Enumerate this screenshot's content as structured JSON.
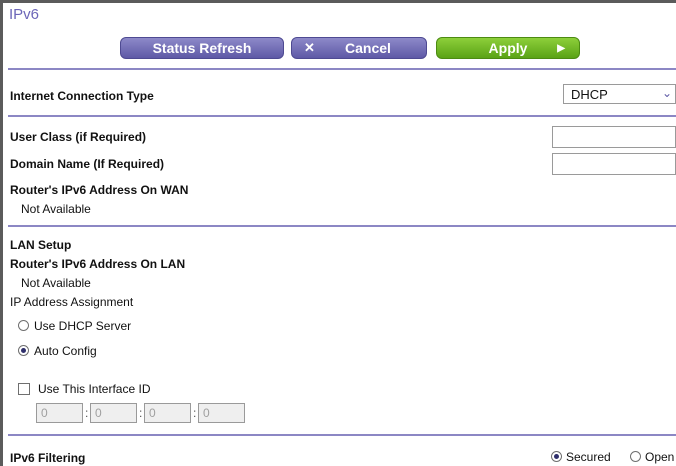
{
  "page": {
    "title": "IPv6"
  },
  "toolbar": {
    "status_refresh": "Status Refresh",
    "cancel": "Cancel",
    "apply": "Apply"
  },
  "connection": {
    "label": "Internet Connection Type",
    "selected": "DHCP"
  },
  "wan": {
    "user_class_label": "User Class (if Required)",
    "user_class_value": "",
    "domain_name_label": "Domain Name  (If Required)",
    "domain_name_value": "",
    "router_addr_label": "Router's IPv6 Address On WAN",
    "router_addr_value": "Not Available"
  },
  "lan": {
    "section_label": "LAN Setup",
    "router_addr_label": "Router's IPv6 Address On LAN",
    "router_addr_value": "Not Available",
    "assignment_label": "IP Address Assignment",
    "options": [
      {
        "label": "Use DHCP Server",
        "checked": false
      },
      {
        "label": "Auto Config",
        "checked": true
      }
    ],
    "interface_id_label": "Use This Interface ID",
    "interface_id_checked": false,
    "interface_id": [
      "0",
      "0",
      "0",
      "0"
    ]
  },
  "filtering": {
    "label": "IPv6 Filtering",
    "options": [
      {
        "label": "Secured",
        "checked": true
      },
      {
        "label": "Open",
        "checked": false
      }
    ]
  },
  "colors": {
    "accent": "#6c66b8",
    "apply_green": "#5aa316",
    "divider": "#8c87c4"
  }
}
